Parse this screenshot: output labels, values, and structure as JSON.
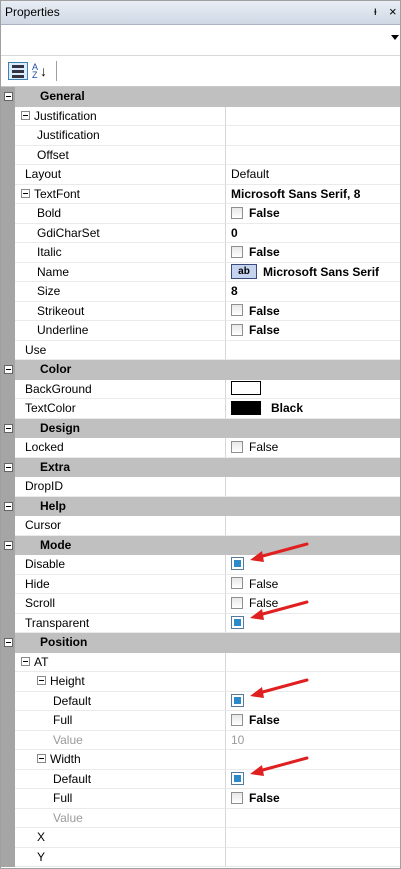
{
  "window": {
    "title": "Properties",
    "pin_glyph": "ᵻ",
    "close_glyph": "×",
    "sort_icon_letters": [
      "A",
      "Z"
    ],
    "sort_icon_arrow": "↓"
  },
  "grid": {
    "categories": {
      "general": "General",
      "color": "Color",
      "design": "Design",
      "extra": "Extra",
      "help": "Help",
      "mode": "Mode",
      "position": "Position"
    },
    "properties": {
      "justification_group": "Justification",
      "justification": "Justification",
      "offset": "Offset",
      "layout": {
        "name": "Layout",
        "value": "Default"
      },
      "textfont": {
        "name": "TextFont",
        "value": "Microsoft Sans Serif, 8"
      },
      "bold": {
        "name": "Bold",
        "value": "False"
      },
      "gdicharset": {
        "name": "GdiCharSet",
        "value": "0"
      },
      "italic": {
        "name": "Italic",
        "value": "False"
      },
      "fontname": {
        "name": "Name",
        "value": "Microsoft Sans Serif",
        "icon_text": "ab"
      },
      "size": {
        "name": "Size",
        "value": "8"
      },
      "strikeout": {
        "name": "Strikeout",
        "value": "False"
      },
      "underline": {
        "name": "Underline",
        "value": "False"
      },
      "use": "Use",
      "background": {
        "name": "BackGround",
        "swatch": "#ffffff"
      },
      "textcolor": {
        "name": "TextColor",
        "value": "Black",
        "swatch": "#000000"
      },
      "locked": {
        "name": "Locked",
        "value": "False"
      },
      "dropid": "DropID",
      "cursor": "Cursor",
      "disable": {
        "name": "Disable",
        "checked": true
      },
      "hide": {
        "name": "Hide",
        "value": "False"
      },
      "scroll": {
        "name": "Scroll",
        "value": "False"
      },
      "transparent": {
        "name": "Transparent",
        "checked": true
      },
      "at": "AT",
      "height": "Height",
      "height_default": {
        "name": "Default",
        "checked": true
      },
      "height_full": {
        "name": "Full",
        "value": "False"
      },
      "height_value": {
        "name": "Value",
        "value": "10"
      },
      "width": "Width",
      "width_default": {
        "name": "Default",
        "checked": true
      },
      "width_full": {
        "name": "Full",
        "value": "False"
      },
      "width_value": {
        "name": "Value"
      },
      "x": "X",
      "y": "Y"
    }
  },
  "colors": {
    "category_bg": "#c0c0c0",
    "margin_bg": "#a5a5a5",
    "checkbox_fill": "#2c8ac9",
    "annotation_arrow": "#e02020"
  },
  "icons": {
    "categorized": "categorized-view-icon",
    "alphabetical": "alphabetical-sort-icon",
    "pin": "pin-icon",
    "close": "close-icon",
    "dropdown": "dropdown-arrow-icon",
    "collapse": "collapse-minus-icon",
    "checkbox": "checkbox-icon",
    "annotation": "red-arrow-icon"
  }
}
